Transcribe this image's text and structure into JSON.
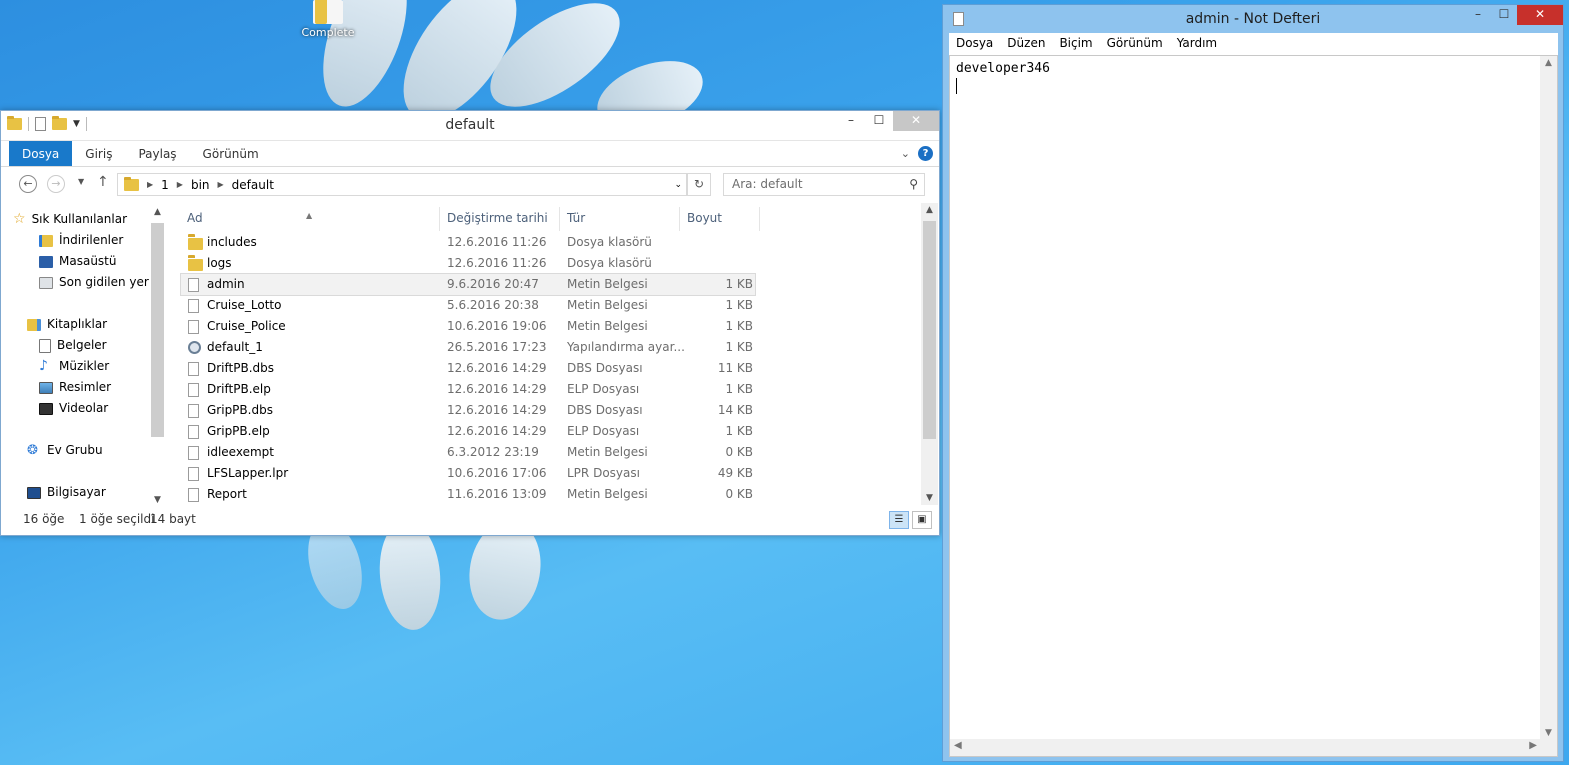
{
  "desktop": {
    "icon_label": "Complete"
  },
  "explorer": {
    "title": "default",
    "ribbon_tabs": [
      "Dosya",
      "Giriş",
      "Paylaş",
      "Görünüm"
    ],
    "breadcrumb": [
      "1",
      "bin",
      "default"
    ],
    "search_placeholder": "Ara: default",
    "nav": {
      "favorites": "Sık Kullanılanlar",
      "favorites_items": [
        "İndirilenler",
        "Masaüstü",
        "Son gidilen yerler"
      ],
      "libraries": "Kitaplıklar",
      "libraries_items": [
        "Belgeler",
        "Müzikler",
        "Resimler",
        "Videolar"
      ],
      "homegroup": "Ev Grubu",
      "computer": "Bilgisayar"
    },
    "columns": {
      "name": "Ad",
      "date": "Değiştirme tarihi",
      "type": "Tür",
      "size": "Boyut"
    },
    "files": [
      {
        "name": "includes",
        "date": "12.6.2016 11:26",
        "type": "Dosya klasörü",
        "size": "",
        "icon": "folder-icon"
      },
      {
        "name": "logs",
        "date": "12.6.2016 11:26",
        "type": "Dosya klasörü",
        "size": "",
        "icon": "folder-icon"
      },
      {
        "name": "admin",
        "date": "9.6.2016 20:47",
        "type": "Metin Belgesi",
        "size": "1 KB",
        "icon": "text-file-icon"
      },
      {
        "name": "Cruise_Lotto",
        "date": "5.6.2016 20:38",
        "type": "Metin Belgesi",
        "size": "1 KB",
        "icon": "text-file-icon"
      },
      {
        "name": "Cruise_Police",
        "date": "10.6.2016 19:06",
        "type": "Metin Belgesi",
        "size": "1 KB",
        "icon": "text-file-icon"
      },
      {
        "name": "default_1",
        "date": "26.5.2016 17:23",
        "type": "Yapılandırma ayar...",
        "size": "1 KB",
        "icon": "config-file-icon"
      },
      {
        "name": "DriftPB.dbs",
        "date": "12.6.2016 14:29",
        "type": "DBS Dosyası",
        "size": "11 KB",
        "icon": "file-icon"
      },
      {
        "name": "DriftPB.elp",
        "date": "12.6.2016 14:29",
        "type": "ELP Dosyası",
        "size": "1 KB",
        "icon": "file-icon"
      },
      {
        "name": "GripPB.dbs",
        "date": "12.6.2016 14:29",
        "type": "DBS Dosyası",
        "size": "14 KB",
        "icon": "file-icon"
      },
      {
        "name": "GripPB.elp",
        "date": "12.6.2016 14:29",
        "type": "ELP Dosyası",
        "size": "1 KB",
        "icon": "file-icon"
      },
      {
        "name": "idleexempt",
        "date": "6.3.2012 23:19",
        "type": "Metin Belgesi",
        "size": "0 KB",
        "icon": "text-file-icon"
      },
      {
        "name": "LFSLapper.lpr",
        "date": "10.6.2016 17:06",
        "type": "LPR Dosyası",
        "size": "49 KB",
        "icon": "file-icon"
      },
      {
        "name": "Report",
        "date": "11.6.2016 13:09",
        "type": "Metin Belgesi",
        "size": "0 KB",
        "icon": "text-file-icon"
      }
    ],
    "selected_index": 2,
    "status": {
      "count": "16 öğe",
      "selected": "1 öğe seçildi",
      "size": "14 bayt"
    }
  },
  "notepad": {
    "title": "admin - Not Defteri",
    "menu": [
      "Dosya",
      "Düzen",
      "Biçim",
      "Görünüm",
      "Yardım"
    ],
    "content": "developer346"
  }
}
